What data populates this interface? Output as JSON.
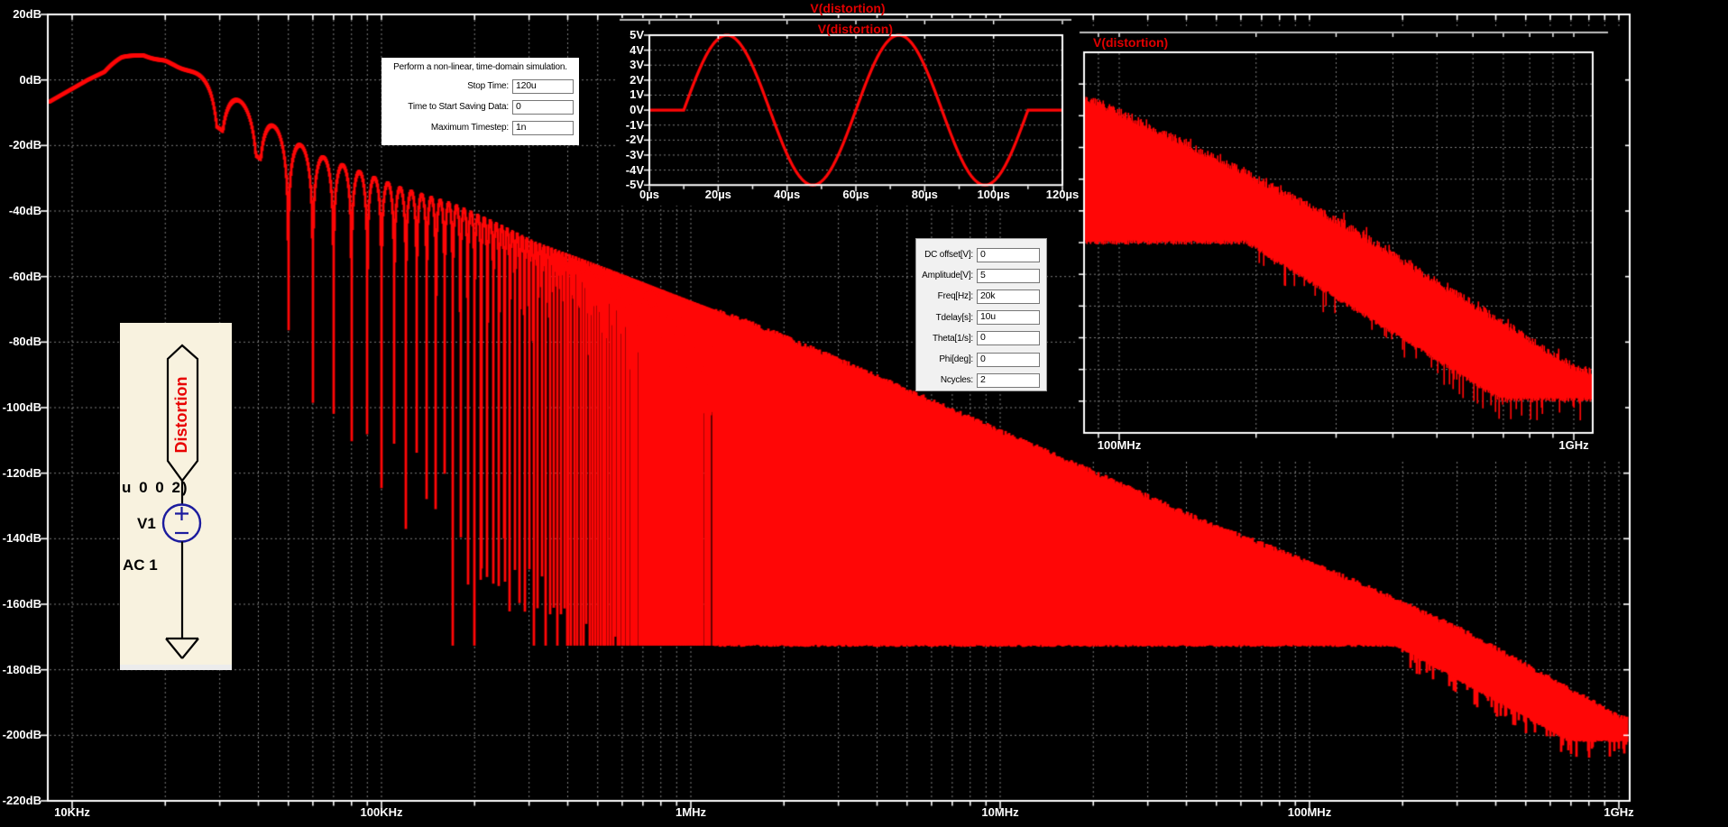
{
  "titles": {
    "main": "V(distortion)",
    "time_inset": "V(distortion)",
    "rf_inset": "V(distortion)"
  },
  "colors": {
    "background": "#000000",
    "trace": "#ff0707",
    "title_red": "#e00000",
    "grid": "#7e7e7e",
    "axis": "#ffffff",
    "schematic_bg": "#f8f2df",
    "source_outline": "#1c1c9e",
    "port_label_red": "#e80000",
    "dialog_bg": "#ffffff",
    "panel_bg": "#f1f1f1"
  },
  "main_plot": {
    "y_axis_labels": [
      "20dB",
      "0dB",
      "-20dB",
      "-40dB",
      "-60dB",
      "-80dB",
      "-100dB",
      "-120dB",
      "-140dB",
      "-160dB",
      "-180dB",
      "-200dB",
      "-220dB"
    ],
    "x_axis_labels": [
      "10KHz",
      "100KHz",
      "1MHz",
      "10MHz",
      "100MHz",
      "1GHz"
    ]
  },
  "time_inset": {
    "y_axis_labels": [
      "5V",
      "4V",
      "3V",
      "2V",
      "1V",
      "0V",
      "-1V",
      "-2V",
      "-3V",
      "-4V",
      "-5V"
    ],
    "x_axis_labels": [
      "0µs",
      "20µs",
      "40µs",
      "60µs",
      "80µs",
      "100µs",
      "120µs"
    ]
  },
  "rf_inset": {
    "x_axis_labels": [
      "100MHz",
      "1GHz"
    ]
  },
  "transient_dialog": {
    "title": "Perform a non-linear, time-domain simulation.",
    "fields": [
      {
        "label": "Stop Time:",
        "value": "120u"
      },
      {
        "label": "Time to Start Saving Data:",
        "value": "0"
      },
      {
        "label": "Maximum Timestep:",
        "value": "1n"
      }
    ]
  },
  "sine_source_panel": {
    "fields": [
      {
        "label": "DC offset[V]:",
        "value": "0"
      },
      {
        "label": "Amplitude[V]:",
        "value": "5"
      },
      {
        "label": "Freq[Hz]:",
        "value": "20k"
      },
      {
        "label": "Tdelay[s]:",
        "value": "10u"
      },
      {
        "label": "Theta[1/s]:",
        "value": "0"
      },
      {
        "label": "Phi[deg]:",
        "value": "0"
      },
      {
        "label": "Ncycles:",
        "value": "2"
      }
    ]
  },
  "schematic": {
    "port_label": "Distortion",
    "netlist_fragment": "u 0 0 2)",
    "designator": "V1",
    "directive": "AC 1"
  },
  "chart_data": [
    {
      "id": "main_fft",
      "type": "line",
      "title": "V(distortion)",
      "x_scale": "log",
      "x_ticks_hz": [
        10000,
        100000,
        1000000,
        10000000,
        100000000,
        1000000000
      ],
      "x_tick_labels": [
        "10KHz",
        "100KHz",
        "1MHz",
        "10MHz",
        "100MHz",
        "1GHz"
      ],
      "x_range_hz": [
        8300,
        1080000000
      ],
      "ylabel": "dB",
      "y_range_db": [
        -220,
        20
      ],
      "y_tick_step_db": 20,
      "grid": true,
      "series": {
        "name": "V(distortion)",
        "description": "FFT magnitude of a 2-cycle 20 kHz 5 V sine burst: sinc-like lobes with nulls every 10 kHz decaying into an FFT noise floor",
        "peak": {
          "freq_hz": 20000,
          "level_db": 8
        },
        "null_spacing_hz": 10000,
        "noise_floor_db": -172,
        "envelope_db_vs_log10f": [
          [
            3.92,
            -5
          ],
          [
            4.05,
            2
          ],
          [
            4.16,
            7
          ],
          [
            4.23,
            8
          ],
          [
            4.33,
            5
          ],
          [
            4.45,
            0
          ],
          [
            4.55,
            -7
          ],
          [
            4.65,
            -14
          ],
          [
            4.77,
            -22
          ],
          [
            4.9,
            -27
          ],
          [
            5.06,
            -33
          ],
          [
            5.23,
            -38
          ],
          [
            5.35,
            -43
          ],
          [
            5.5,
            -50
          ],
          [
            5.7,
            -57
          ],
          [
            6.0,
            -68
          ],
          [
            6.22,
            -76
          ],
          [
            6.5,
            -87
          ],
          [
            7.0,
            -108
          ],
          [
            7.15,
            -114
          ],
          [
            7.67,
            -136
          ],
          [
            8.0,
            -148
          ],
          [
            8.25,
            -158
          ],
          [
            8.5,
            -169
          ],
          [
            8.75,
            -182
          ],
          [
            9.0,
            -195
          ],
          [
            9.3,
            -203
          ]
        ]
      }
    },
    {
      "id": "time_waveform",
      "type": "line",
      "title": "V(distortion)",
      "x_unit": "µs",
      "x_range": [
        0,
        120
      ],
      "x_tick_step": 20,
      "y_unit": "V",
      "y_range": [
        -5,
        5
      ],
      "y_tick_step": 1,
      "grid": true,
      "signal": {
        "shape": "sine burst",
        "dc_offset_v": 0,
        "amplitude_v": 5,
        "freq_hz": 20000,
        "period_us": 50,
        "tdelay_us": 10,
        "ncycles": 2
      }
    },
    {
      "id": "rf_zoom_fft",
      "type": "line",
      "title": "V(distortion)",
      "x_scale": "log",
      "x_ticks_hz": [
        100000000,
        1000000000
      ],
      "x_tick_labels": [
        "100MHz",
        "1GHz"
      ],
      "x_range_hz": [
        84000000,
        1100000000
      ],
      "y_axis": "unlabeled dB",
      "grid": true,
      "series": {
        "name": "V(distortion)",
        "description": "Same FFT zoomed to 100MHz-1GHz: dense noise band between the decaying envelope and the noise floor"
      }
    }
  ]
}
